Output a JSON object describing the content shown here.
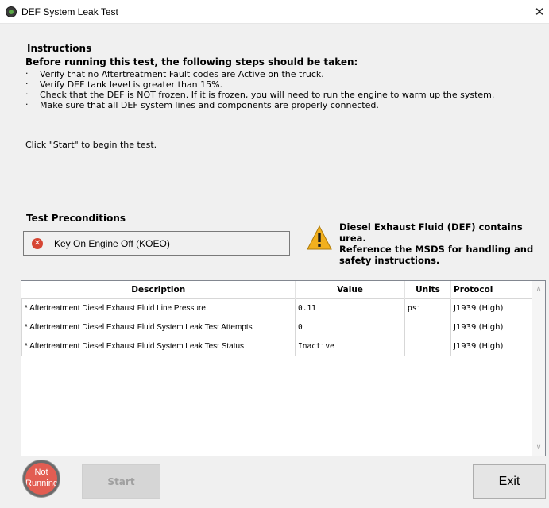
{
  "window": {
    "title": "DEF System Leak Test",
    "close_glyph": "✕",
    "app_icon": "app-logo-icon"
  },
  "instructions": {
    "heading": "Instructions",
    "subheading": "Before running this test, the following steps should be taken:",
    "bullet": "·",
    "steps": [
      "Verify that no Aftertreatment Fault codes are Active on the truck.",
      "Verify DEF tank level is greater than 15%.",
      "Check that the DEF is NOT frozen. If it is frozen, you will need to run the engine to warm up the system.",
      "Make sure that all DEF system lines and components are properly connected."
    ],
    "click_start": "Click \"Start\" to begin the test."
  },
  "preconditions": {
    "heading": "Test Preconditions",
    "items": [
      {
        "label": "Key On Engine Off (KOEO)",
        "status": "failed",
        "icon": "error-x-icon",
        "icon_glyph": "✕",
        "color": "#d64533"
      }
    ]
  },
  "warning": {
    "icon": "warning-triangle-icon",
    "text_line1": "Diesel Exhaust Fluid (DEF) contains urea.",
    "text_line2": "Reference the MSDS for handling and",
    "text_line3": "safety instructions.",
    "color": "#f2b01e"
  },
  "grid": {
    "columns": [
      "Description",
      "Value",
      "Units",
      "Protocol"
    ],
    "rows": [
      {
        "description": "* Aftertreatment Diesel Exhaust Fluid Line Pressure",
        "value": "0.11",
        "units": "psi",
        "protocol": "J1939 (High)"
      },
      {
        "description": "* Aftertreatment Diesel Exhaust Fluid System Leak Test Attempts",
        "value": "0",
        "units": "",
        "protocol": "J1939 (High)"
      },
      {
        "description": "* Aftertreatment Diesel Exhaust Fluid System Leak Test Status",
        "value": "Inactive",
        "units": "",
        "protocol": "J1939 (High)"
      }
    ],
    "scroll_up_glyph": "∧",
    "scroll_down_glyph": "∨"
  },
  "footer": {
    "status_line1": "Not",
    "status_line2": "Running",
    "status_color": "#e25d52",
    "start_label": "Start",
    "start_enabled": false,
    "exit_label": "Exit"
  }
}
